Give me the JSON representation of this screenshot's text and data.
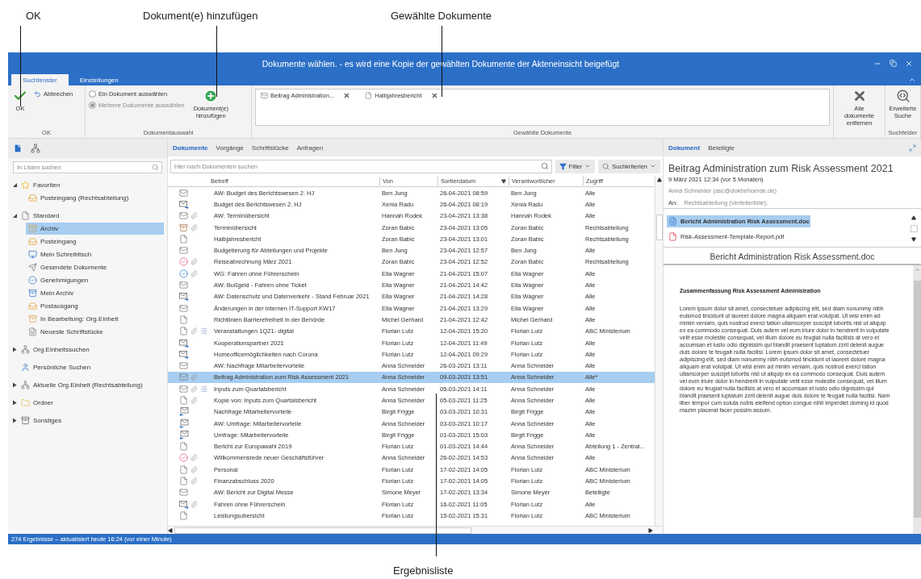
{
  "annotations": {
    "top": [
      "OK",
      "Dokument(e) hinzufügen",
      "Gewählte Dokumente"
    ],
    "bottom": "Ergebnisliste"
  },
  "window": {
    "title": "Dokumente wählen. - es wird eine Kopie der gewählten Dokumente der Akteneinsicht beigefügt"
  },
  "ribbon_tabs": [
    {
      "label": "Suchfenster",
      "selected": true
    },
    {
      "label": "Einstellungen",
      "selected": false
    }
  ],
  "ribbon": {
    "ok": "OK",
    "cancel": "Abbrechen",
    "ok_group": "OK",
    "radios": [
      {
        "label": "Ein Dokument auswählen",
        "selected": false,
        "disabled": false
      },
      {
        "label": "Mehrere Dokumente auswählen",
        "selected": true,
        "disabled": true
      }
    ],
    "add": "Dokument(e) hinzufügen",
    "selection_group": "Dokumentauswahl",
    "chips": [
      {
        "kind": "mail",
        "label": "Beitrag Administration..."
      },
      {
        "kind": "doc",
        "label": "Halbjahresbericht"
      }
    ],
    "chips_group": "Gewählte Dokumente",
    "remove_all": "Alle dokumente entfernen",
    "advanced": "Erweiterte Suche",
    "search_group": "Suchfelder"
  },
  "sidebar": {
    "search": {
      "placeholder": "In Listen suchen"
    },
    "tree": [
      {
        "kind": "star",
        "label": "Favoriten",
        "expanded": true,
        "children": [
          {
            "kind": "inbox",
            "label": "Posteingang (Rechtsabteilung)",
            "selected": false
          }
        ]
      },
      {
        "kind": "box",
        "label": "Standard",
        "expanded": true,
        "children": [
          {
            "kind": "archive",
            "label": "Archiv",
            "selected": true
          },
          {
            "kind": "inbox",
            "label": "Posteingang",
            "selected": false
          },
          {
            "kind": "desk",
            "label": "Mein Schreibtisch",
            "selected": false
          },
          {
            "kind": "sent",
            "label": "Gesendete Dokumente",
            "selected": false
          },
          {
            "kind": "approve",
            "label": "Genehmigungen",
            "selected": false
          },
          {
            "kind": "myarchive",
            "label": "Mein Archiv",
            "selected": false
          },
          {
            "kind": "outbox",
            "label": "Postausgang",
            "selected": false
          },
          {
            "kind": "archive",
            "label": "In Bearbeitung: Org.Einheit",
            "selected": false
          },
          {
            "kind": "page",
            "label": "Neueste Schriftstücke",
            "selected": false
          }
        ]
      },
      {
        "kind": "org",
        "label": "Org.Einheitssuchen",
        "expanded": false
      },
      {
        "kind": "person",
        "label": "Persönliche Suchen"
      },
      {
        "kind": "org",
        "label": "Aktuelle Org.Einheit (Rechtsabteilung)",
        "expanded": false
      },
      {
        "kind": "folder",
        "label": "Ordner",
        "expanded": false
      },
      {
        "kind": "misc",
        "label": "Sonstiges",
        "expanded": false
      }
    ]
  },
  "results": {
    "tabs": [
      {
        "label": "Dokumente",
        "selected": true
      },
      {
        "label": "Vorgänge",
        "selected": false
      },
      {
        "label": "Schriftstücke",
        "selected": false
      },
      {
        "label": "Anfragen",
        "selected": false
      }
    ],
    "search": {
      "placeholder": "Hier nach Dokumenten suchen"
    },
    "filter": "Filter",
    "criteria": "Suchkriterien",
    "columns": [
      "Betreff",
      "Von",
      "Sortierdatum",
      "Verantwortlicher",
      "Zugriff"
    ],
    "rows": [
      {
        "kind": "mail",
        "attachment": false,
        "list": false,
        "selected": false,
        "cells": [
          "AW: Budget des Berichtswesen 2. HJ",
          "Ben Jung",
          "26-04-2021 08:59",
          "Ben Jung",
          "Alle"
        ]
      },
      {
        "kind": "mail-in",
        "attachment": false,
        "list": false,
        "selected": false,
        "cells": [
          "Budget des Berichtswesen 2. HJ",
          "Xenia Radu",
          "26-04-2021 08:19",
          "Xenia Radu",
          "Alle"
        ]
      },
      {
        "kind": "mail",
        "attachment": true,
        "list": false,
        "selected": false,
        "cells": [
          "AW: Terminübersicht",
          "Hannah Rodek",
          "23-04-2021 13:38",
          "Hannah Rodek",
          "Alle"
        ]
      },
      {
        "kind": "archive",
        "attachment": true,
        "list": false,
        "selected": false,
        "cells": [
          "Terminübersicht",
          "Zoran Babic",
          "23-04-2021 13:05",
          "Zoran Babic",
          "Rechtsabteilung"
        ]
      },
      {
        "kind": "doc",
        "attachment": false,
        "list": false,
        "selected": false,
        "cells": [
          "Halbjahresbericht",
          "Zoran Babic",
          "23-04-2021 13:01",
          "Zoran Babic",
          "Rechtsabteilung"
        ]
      },
      {
        "kind": "mail",
        "attachment": false,
        "list": false,
        "selected": false,
        "cells": [
          "Budgetierung für Abteilungen und Projekte",
          "Ben Jung",
          "23-04-2021 12:57",
          "Ben Jung",
          "Alle"
        ]
      },
      {
        "kind": "pending",
        "attachment": true,
        "list": false,
        "selected": false,
        "cells": [
          "Reiseabrechnung März 2021",
          "Zoran Babic",
          "23-04-2021 12:52",
          "Zoran Babic",
          "Rechtsabteilung"
        ]
      },
      {
        "kind": "approved",
        "attachment": true,
        "list": false,
        "selected": false,
        "cells": [
          "WG: Fahren ohne Führerschein",
          "Ella Wagner",
          "21-04-2021 15:07",
          "Ella Wagner",
          "Alle"
        ]
      },
      {
        "kind": "mail",
        "attachment": false,
        "list": false,
        "selected": false,
        "cells": [
          "AW: Bußgeld - Fahren ohne Ticket",
          "Ella Wagner",
          "21-04-2021 14:42",
          "Ella Wagner",
          "Alle"
        ]
      },
      {
        "kind": "mail-in",
        "attachment": false,
        "list": false,
        "selected": false,
        "cells": [
          "AW: Datenschutz und Datenverkehr - Stand Februar 2021",
          "Ella Wagner",
          "21-04-2021 14:28",
          "Ella Wagner",
          "Alle"
        ]
      },
      {
        "kind": "mail",
        "attachment": false,
        "list": false,
        "selected": false,
        "cells": [
          "Änderungen in der internen IT-Support KW17",
          "Ella Wagner",
          "21-04-2021 13:29",
          "Ella Wagner",
          "Alle"
        ]
      },
      {
        "kind": "doc",
        "attachment": false,
        "list": false,
        "selected": false,
        "cells": [
          "Richtlinien Barrierefreiheit in der Behörde",
          "Michel Gerhard",
          "21-04-2021 12:42",
          "Michel Gerhard",
          "Alle"
        ]
      },
      {
        "kind": "doc",
        "attachment": true,
        "list": true,
        "selected": false,
        "cells": [
          "Veranstaltungen 1Q21- digital",
          "Florian Lutz",
          "12-04-2021 15:20",
          "Florian Lutz",
          "ABC Ministerium"
        ]
      },
      {
        "kind": "mail-in",
        "attachment": false,
        "list": false,
        "selected": false,
        "cells": [
          "Kooperationspartner 2021",
          "Florian Lutz",
          "12-04-2021 11:49",
          "Florian Lutz",
          "Alle"
        ]
      },
      {
        "kind": "mail-in",
        "attachment": false,
        "list": false,
        "selected": false,
        "cells": [
          "Homeofficemöglichkeiten nach Corona",
          "Florian Lutz",
          "12-04-2021 09:29",
          "Florian Lutz",
          "Alle"
        ]
      },
      {
        "kind": "mail",
        "attachment": false,
        "list": false,
        "selected": false,
        "cells": [
          "AW: Nachfrage Mitarbeitervorteile",
          "Anna Schneider",
          "26-03-2021 13:11",
          "Anna Schneider",
          "Alle"
        ]
      },
      {
        "kind": "mail",
        "attachment": true,
        "list": false,
        "selected": true,
        "cells": [
          "Beitrag Administration zum Risk Assessment 2021",
          "Anna Schneider",
          "09-03-2021 13:51",
          "Anna Schneider",
          "Alle*"
        ]
      },
      {
        "kind": "mail",
        "attachment": true,
        "list": true,
        "selected": false,
        "cells": [
          "Inputs zum Quartalsbericht",
          "Anna Schneider",
          "05-03-2021 14:11",
          "Anna Schneider",
          "Alle"
        ]
      },
      {
        "kind": "doc",
        "attachment": true,
        "list": false,
        "selected": false,
        "cells": [
          "Kopie von: Inputs zum Quartalsbericht",
          "Anna Schneider",
          "05-03-2021 11:25",
          "Anna Schneider",
          "Alle"
        ]
      },
      {
        "kind": "mail-out",
        "attachment": false,
        "list": false,
        "selected": false,
        "cells": [
          "Nachfrage Mitarbeitervorteile",
          "Birgit Frigge",
          "03-03-2021 10:31",
          "Birgit Frigge",
          "Alle"
        ]
      },
      {
        "kind": "mail-out",
        "attachment": false,
        "list": false,
        "selected": false,
        "cells": [
          "AW: Umfrage: Mitarbeitervorteile",
          "Anna Schneider",
          "03-03-2021 10:17",
          "Anna Schneider",
          "Alle"
        ]
      },
      {
        "kind": "mail-out",
        "attachment": false,
        "list": false,
        "selected": false,
        "cells": [
          "Umfrage: Mitarbeitervorteile",
          "Birgit Frigge",
          "01-03-2021 15:03",
          "Birgit Frigge",
          "Alle"
        ]
      },
      {
        "kind": "doc",
        "attachment": false,
        "list": false,
        "selected": false,
        "cells": [
          "Bericht zur Europawahl 2019",
          "Florian Lutz",
          "01-03-2021 14:44",
          "Anna Schneider",
          "Abteilung 1 - Zentral..."
        ]
      },
      {
        "kind": "pending",
        "attachment": true,
        "list": false,
        "selected": false,
        "cells": [
          "Willkommensrede neuer Geschäftsführer",
          "Anna Schneider",
          "26-02-2021 14:53",
          "Anna Schneider",
          "Alle"
        ]
      },
      {
        "kind": "doc",
        "attachment": true,
        "list": false,
        "selected": false,
        "cells": [
          "Personal",
          "Florian Lutz",
          "17-02-2021 14:05",
          "Florian Lutz",
          "ABC Ministerium"
        ]
      },
      {
        "kind": "doc",
        "attachment": true,
        "list": false,
        "selected": false,
        "cells": [
          "Finanzabschluss 2020",
          "Florian Lutz",
          "17-02-2021 14:05",
          "Florian Lutz",
          "ABC Ministerium"
        ]
      },
      {
        "kind": "mail",
        "attachment": false,
        "list": false,
        "selected": false,
        "cells": [
          "AW: Bericht zur Digital Messe",
          "Simone Meyer",
          "17-02-2021 13:34",
          "Simone Meyer",
          "Beteiligte"
        ]
      },
      {
        "kind": "mail-in",
        "attachment": true,
        "list": false,
        "selected": false,
        "cells": [
          "Fahren ohne Führerschein",
          "Florian Lutz",
          "16-02-2021 11:05",
          "Florian Lutz",
          "Alle"
        ]
      },
      {
        "kind": "doc",
        "attachment": false,
        "list": false,
        "selected": false,
        "cells": [
          "Leistungsubersicht",
          "Florian Lutz",
          "15-02-2021 15:31",
          "Florian Lutz",
          "ABC Ministerium"
        ]
      }
    ]
  },
  "preview": {
    "tabs": [
      {
        "label": "Dokument",
        "selected": true
      },
      {
        "label": "Beteiligte",
        "selected": false
      }
    ],
    "title": "Beitrag Administration zum Risk Assessment 2021",
    "date": "9 März 2021 12:34 (vor 5 Monaten)",
    "sender": "Anna Schneider (asc@dokbehoerde.de)",
    "to_label": "An:",
    "to": "Rechtsabteilung (Verteilerliste);",
    "attachments": [
      {
        "kind": "word",
        "label": "Bericht Administration Risk Assessment.doc",
        "selected": true
      },
      {
        "kind": "pdf",
        "label": "Risk-Assessment-Template-Report.pdf",
        "selected": false
      }
    ],
    "file_title": "Bericht Administration Risk Assessment.doc",
    "doc_heading": "Zusammenfassung Risk Assessment Administration",
    "doc_text": "Lorem ipsum dolor sit amet, consectetuer adipiscing elit, sed diam nonummy nibh euismod tincidunt ut laoreet dolore magna aliquam erat volutpat. Ut wisi enim ad minim veniam, quis nostrud exerci tation ullamcorper suscipit lobortis nisl ut aliquip ex ea commodo consequat. Duis autem vel eum iriure dolor in hendrerit in vulputate velit esse molestie consequat, vel illum dolore eu feugiat nulla facilisis at vero et accumsan et iusto odio dignissim qui blandit praesent luptatum zzril delenit augue duis dolore te feugait nulla facilisi. Lorem ipsum dolor sit amet, consectetuer adipiscing elit, sed diam nonummy nibh euismod tincidunt ut laoreet dolore magna aliquam erat volutpat. Ut wisi enim ad minim veniam, quis nostrud exerci tation ullamcorper suscipit lobortis nisl ut aliquip ex ea commodo consequat. Duis autem vel eum iriure dolor in hendrerit in vulputate velit esse molestie consequat, vel illum dolore eu feugiat nulla facilisis at vero et accumsan et iusto odio dignissim qui blandit praesent luptatum zzril delenit augue duis dolore te feugait nulla facilisi. Nam liber tempor cum soluta nobis eleifend option congue nihil imperdiet doming id quod mazim placerat facer possim assum."
  },
  "status_bar": "274 Ergebnisse – aktualisiert heute 16:24 (vor einer Minute)"
}
